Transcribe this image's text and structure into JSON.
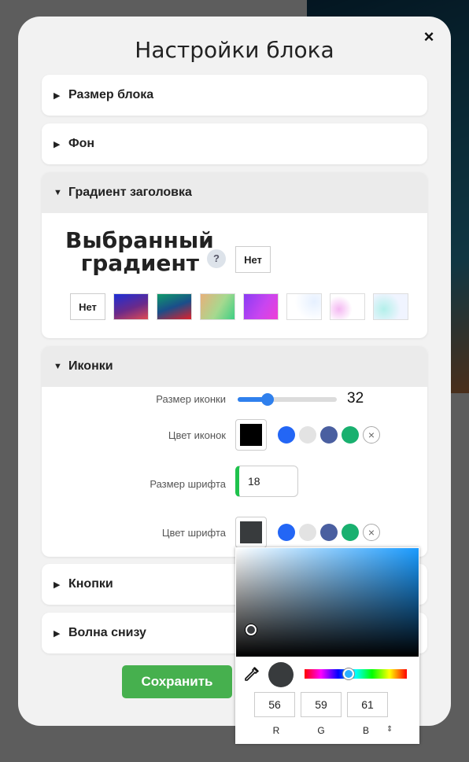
{
  "modal": {
    "title": "Настройки блока",
    "close_symbol": "×"
  },
  "sections": {
    "block_size": {
      "label": "Размер блока"
    },
    "background": {
      "label": "Фон"
    },
    "title_gradient": {
      "label": "Градиент заголовка",
      "selected_label": "Выбранный градиент",
      "help_symbol": "?",
      "selected_value": "Нет",
      "options": [
        {
          "label": "Нет"
        },
        {
          "gradient": "linear-gradient(160deg, #1d2fd6, #6b2a8a 55%, #e04a52)"
        },
        {
          "gradient": "linear-gradient(160deg, #0f9b6b, #1a4e8a 50%, #e0202a)"
        },
        {
          "gradient": "linear-gradient(120deg, #e8b07a, #a6d98f 55%, #3ecf84)"
        },
        {
          "gradient": "linear-gradient(120deg, #8a3cf4, #c845f0 55%, #ef3fd6)"
        },
        {
          "gradient": "radial-gradient(circle at 80% 30%, #e6f0ff, #fff 60%)"
        },
        {
          "gradient": "radial-gradient(circle at 25% 60%, #f4b8f2, #fff 45%), radial-gradient(circle at 70% 40%, #a5d8ff, #fff 40%)"
        },
        {
          "gradient": "radial-gradient(circle at 30% 60%, #b3f0ea, #f0f4ff 60%)"
        }
      ]
    },
    "icons": {
      "label": "Иконки",
      "icon_size_label": "Размер иконки",
      "icon_size_value": "32",
      "icon_size_fraction": 0.3,
      "icon_color_label": "Цвет иконок",
      "icon_color": "#000000",
      "font_size_label": "Размер шрифта",
      "font_size_value": "18",
      "font_color_label": "Цвет шрифта",
      "font_color": "#383b3d",
      "preset_colors": [
        "#2366f5",
        "#e3e3e3",
        "#4a5fa0",
        "#19b06f"
      ],
      "clear_symbol": "×"
    },
    "buttons": {
      "label": "Кнопки"
    },
    "wave": {
      "label": "Волна снизу"
    }
  },
  "save_button": {
    "label": "Сохранить"
  },
  "color_picker": {
    "r": "56",
    "g": "59",
    "b": "61",
    "r_label": "R",
    "g_label": "G",
    "b_label": "B",
    "toggle_symbol": "⇕",
    "hue_fraction": 0.43
  },
  "colors": {
    "accent_blue": "#2f80ed",
    "save_green": "#46b04e",
    "input_accent": "#1fc24d"
  }
}
